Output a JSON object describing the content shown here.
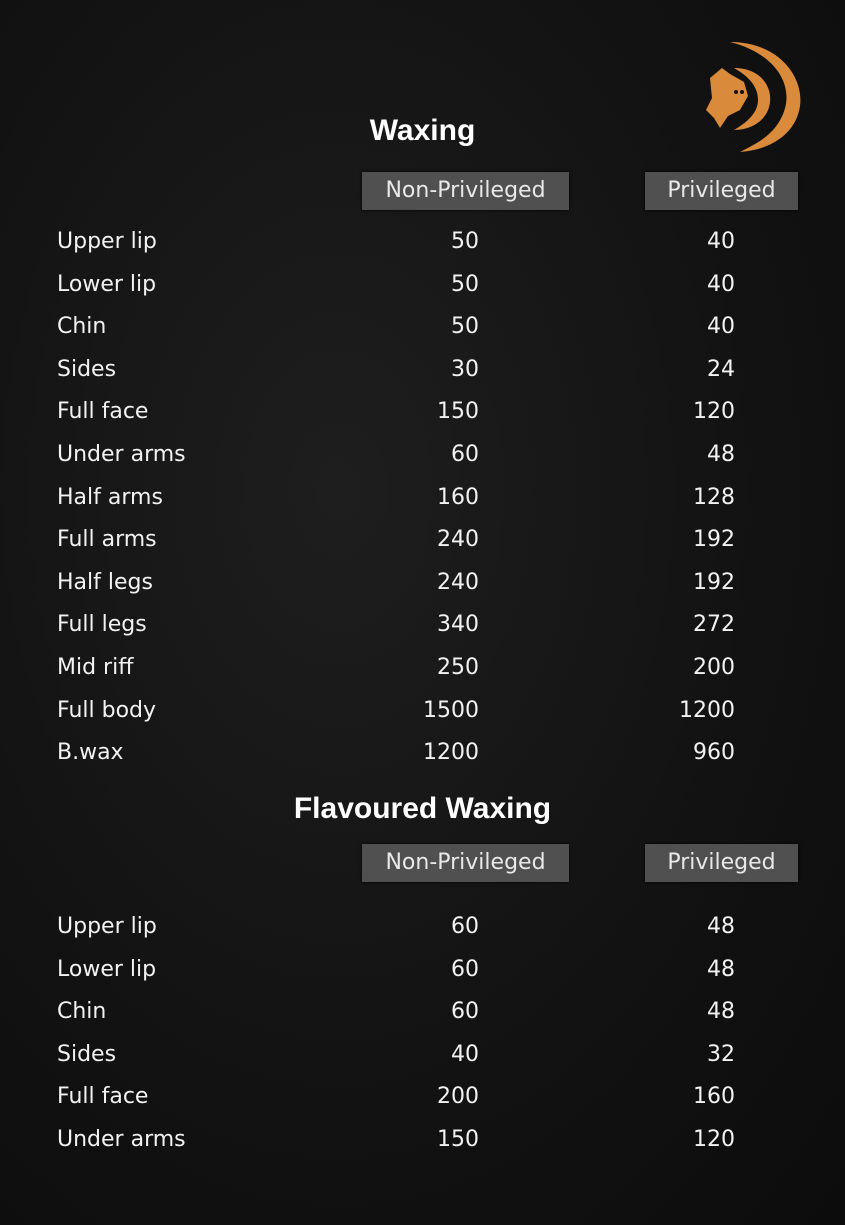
{
  "logo": {
    "color": "#d98a3a",
    "icon": "lion-d-logo"
  },
  "sections": [
    {
      "title": "Waxing",
      "col_headers": [
        "Non-Privileged",
        "Privileged"
      ],
      "rows": [
        {
          "service": "Upper lip",
          "non_privileged": "50",
          "privileged": "40"
        },
        {
          "service": "Lower lip",
          "non_privileged": "50",
          "privileged": "40"
        },
        {
          "service": "Chin",
          "non_privileged": "50",
          "privileged": "40"
        },
        {
          "service": "Sides",
          "non_privileged": "30",
          "privileged": "24"
        },
        {
          "service": "Full face",
          "non_privileged": "150",
          "privileged": "120"
        },
        {
          "service": "Under arms",
          "non_privileged": "60",
          "privileged": "48"
        },
        {
          "service": "Half arms",
          "non_privileged": "160",
          "privileged": "128"
        },
        {
          "service": "Full arms",
          "non_privileged": "240",
          "privileged": "192"
        },
        {
          "service": "Half legs",
          "non_privileged": "240",
          "privileged": "192"
        },
        {
          "service": "Full legs",
          "non_privileged": "340",
          "privileged": "272"
        },
        {
          "service": "Mid riff",
          "non_privileged": "250",
          "privileged": "200"
        },
        {
          "service": "Full body",
          "non_privileged": "1500",
          "privileged": "1200"
        },
        {
          "service": "B.wax",
          "non_privileged": "1200",
          "privileged": "960"
        }
      ]
    },
    {
      "title": "Flavoured Waxing",
      "col_headers": [
        "Non-Privileged",
        "Privileged"
      ],
      "rows": [
        {
          "service": "Upper lip",
          "non_privileged": "60",
          "privileged": "48"
        },
        {
          "service": "Lower lip",
          "non_privileged": "60",
          "privileged": "48"
        },
        {
          "service": "Chin",
          "non_privileged": "60",
          "privileged": "48"
        },
        {
          "service": "Sides",
          "non_privileged": "40",
          "privileged": "32"
        },
        {
          "service": "Full face",
          "non_privileged": "200",
          "privileged": "160"
        },
        {
          "service": "Under arms",
          "non_privileged": "150",
          "privileged": "120"
        }
      ]
    }
  ]
}
